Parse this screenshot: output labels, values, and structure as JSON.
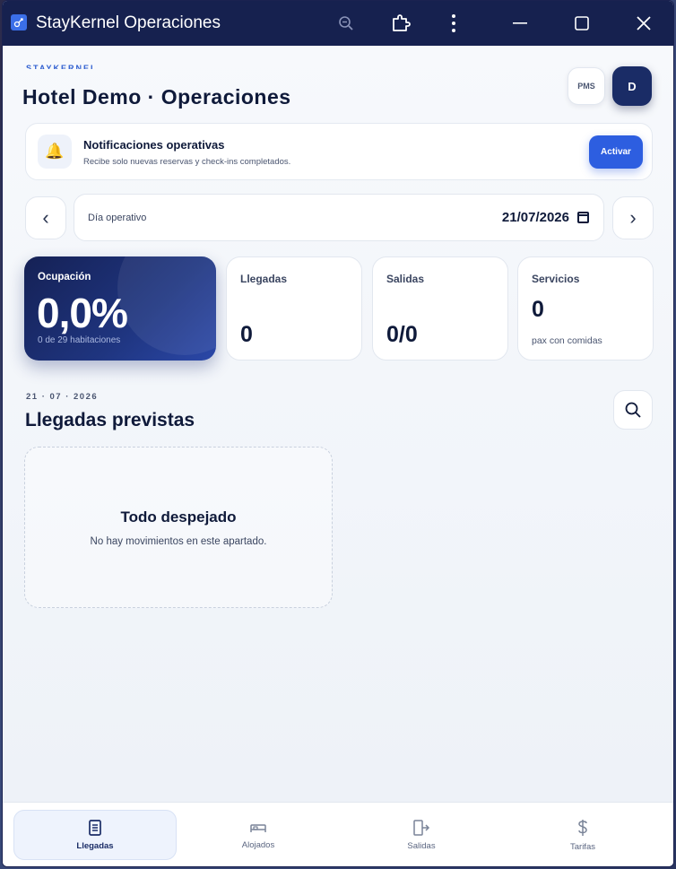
{
  "window": {
    "title": "StayKernel Operaciones",
    "minimize": "─",
    "maximize": "☐",
    "close": "✕"
  },
  "header": {
    "brand": "STAYKERNEL",
    "title": "Hotel Demo · Operaciones",
    "pms_label": "PMS",
    "avatar_initial": "D"
  },
  "notifications": {
    "title": "Notificaciones operativas",
    "subtitle": "Recibe solo nuevas reservas y check-ins completados.",
    "button": "Activar"
  },
  "day": {
    "label": "Día operativo",
    "value": "21/07/2026",
    "prev": "‹",
    "next": "›"
  },
  "stats": {
    "occupancy": {
      "label": "Ocupación",
      "value": "0,0%",
      "sub": "0 de 29 habitaciones"
    },
    "arrivals": {
      "label": "Llegadas",
      "value": "0"
    },
    "departures": {
      "label": "Salidas",
      "value": "0/0"
    },
    "services": {
      "label": "Servicios",
      "value": "0",
      "sub": "pax con comidas"
    }
  },
  "section": {
    "date": "21 · 07 · 2026",
    "title": "Llegadas previstas"
  },
  "empty": {
    "title": "Todo despejado",
    "subtitle": "No hay movimientos en este apartado."
  },
  "tabs": [
    {
      "label": "Llegadas",
      "icon": "document-icon",
      "active": true
    },
    {
      "label": "Alojados",
      "icon": "bed-icon",
      "active": false
    },
    {
      "label": "Salidas",
      "icon": "exit-icon",
      "active": false
    },
    {
      "label": "Tarifas",
      "icon": "dollar-icon",
      "active": false
    }
  ]
}
